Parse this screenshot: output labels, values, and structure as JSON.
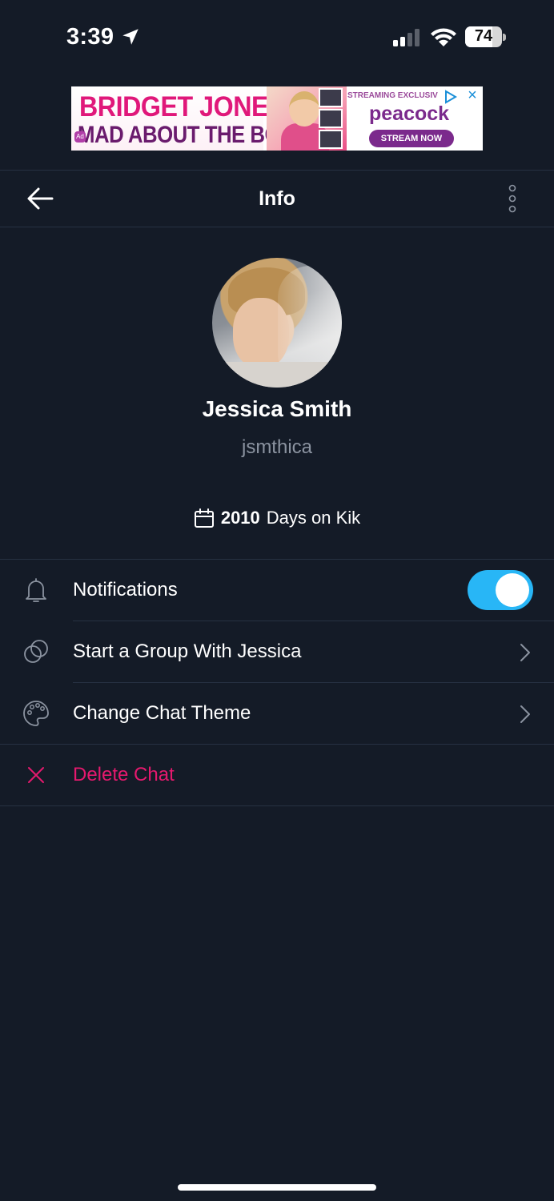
{
  "status_bar": {
    "time": "3:39",
    "battery": "74"
  },
  "ad": {
    "title_line1": "BRIDGET JONES",
    "title_line2": "MAD ABOUT THE BOY",
    "badge": "Ad",
    "tagline": "STREAMING EXCLUSIV",
    "brand": "peacock",
    "cta": "STREAM NOW",
    "close_glyph": "×",
    "colors": {
      "title": "#e0187a",
      "subtitle": "#6a1b6d",
      "brand": "#7b2a8c"
    }
  },
  "header": {
    "title": "Info",
    "back_icon": "arrow-left-icon",
    "more_icon": "vertical-dots-icon"
  },
  "profile": {
    "name": "Jessica Smith",
    "username": "jsmthica",
    "days_count": "2010",
    "days_label": "Days on Kik"
  },
  "menu": {
    "notifications": {
      "label": "Notifications",
      "icon": "bell-icon",
      "enabled": true
    },
    "start_group": {
      "label": "Start a Group With Jessica",
      "icon": "group-circles-icon"
    },
    "change_theme": {
      "label": "Change Chat Theme",
      "icon": "palette-icon"
    },
    "delete_chat": {
      "label": "Delete Chat",
      "icon": "close-x-icon"
    }
  },
  "colors": {
    "background": "#141b27",
    "accent": "#28b6f6",
    "danger": "#e5196e",
    "secondary_text": "#8b93a0"
  }
}
